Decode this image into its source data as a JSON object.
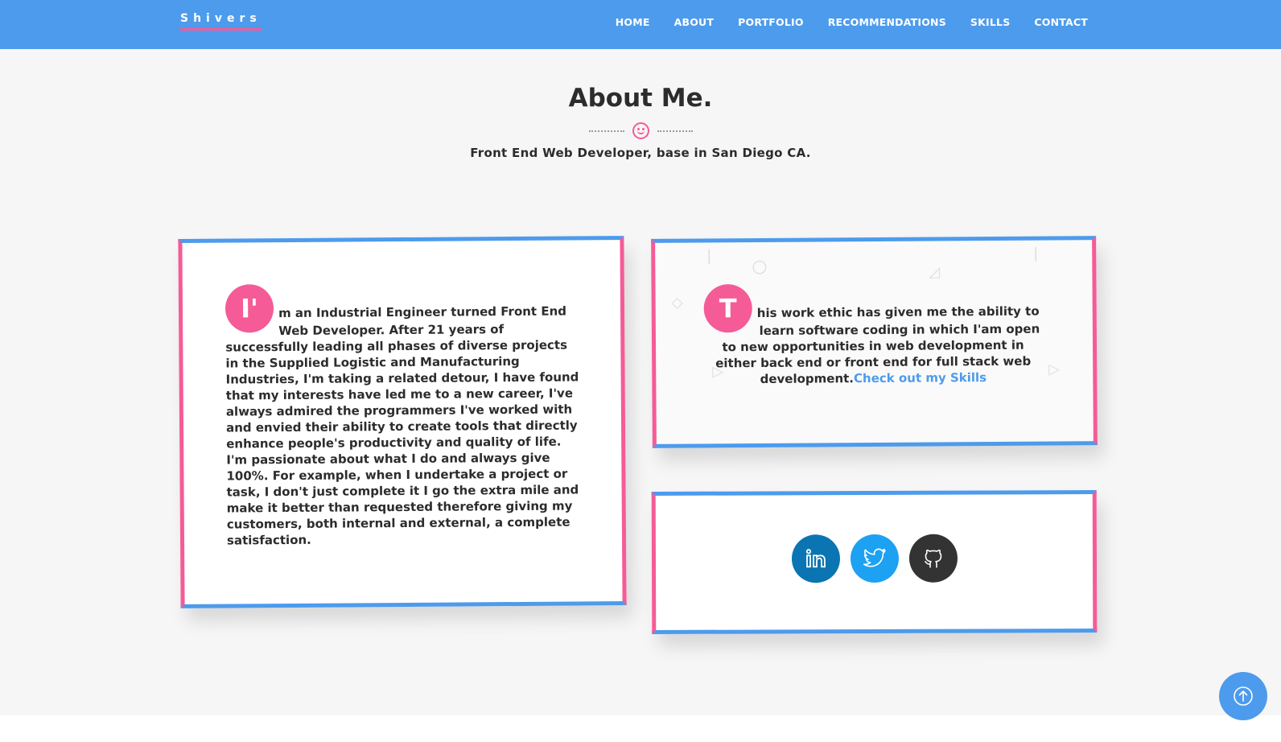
{
  "nav": {
    "brand": "Shivers",
    "links": [
      "HOME",
      "ABOUT",
      "PORTFOLIO",
      "RECOMMENDATIONS",
      "SKILLS",
      "CONTACT"
    ]
  },
  "about": {
    "title": "About Me.",
    "subtitle": "Front End Web Developer, base in San Diego CA."
  },
  "card1": {
    "dropcap": "I'",
    "first_line": "m an Industrial Engineer turned Front End",
    "body": "Web Developer. After 21 years of successfully leading all phases of diverse projects in the Supplied Logistic and Manufacturing Industries, I'm taking a related detour, I have found that my interests have led me to a new career, I've always admired the programmers I've worked with and envied their ability to create tools that directly enhance people's productivity and quality of life. I'm passionate about what I do and always give 100%. For example, when I undertake a project or task, I don't just complete it I go the extra mile and make it better than requested therefore giving my customers, both internal and external, a complete satisfaction."
  },
  "card2": {
    "dropcap": "T",
    "first_line": "his work ethic has given me the ability to",
    "body": "learn software coding in which I'am open to new opportunities in web development in either back end or front end for full stack web development.",
    "link_label": "Check out my Skills"
  },
  "social": {
    "icons": [
      "linkedin-icon",
      "twitter-icon",
      "github-icon"
    ]
  },
  "colors": {
    "primary": "#4d9bec",
    "accent": "#f55b97",
    "linkedin": "#0a75b2",
    "twitter": "#1da1f2",
    "github": "#333333"
  }
}
